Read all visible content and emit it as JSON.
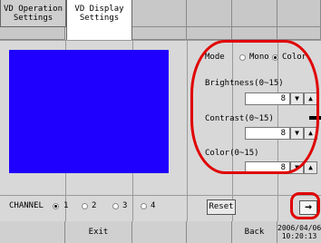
{
  "tabs": [
    {
      "line1": "VD Operation",
      "line2": "Settings",
      "active": false
    },
    {
      "line1": "VD Display",
      "line2": "Settings",
      "active": true
    }
  ],
  "settings": {
    "mode_label": "Mode",
    "mode_options": [
      {
        "label": "Mono",
        "selected": false
      },
      {
        "label": "Color",
        "selected": true
      }
    ],
    "brightness": {
      "label": "Brightness(0~15)",
      "value": "8"
    },
    "contrast": {
      "label": "Contrast(0~15)",
      "value": "8"
    },
    "color": {
      "label": "Color(0~15)",
      "value": "8"
    }
  },
  "stepper": {
    "down": "▼",
    "up": "▲"
  },
  "channel": {
    "label": "CHANNEL",
    "options": [
      {
        "label": "1",
        "selected": true
      },
      {
        "label": "2",
        "selected": false
      },
      {
        "label": "3",
        "selected": false
      },
      {
        "label": "4",
        "selected": false
      }
    ]
  },
  "reset_label": "Reset",
  "arrow_icon": "→",
  "footer": {
    "exit_label": "Exit",
    "back_label": "Back",
    "date": "2006/04/06",
    "time": "10:20:13"
  },
  "colors": {
    "preview": "#1f00ff",
    "highlight": "#e00000"
  }
}
